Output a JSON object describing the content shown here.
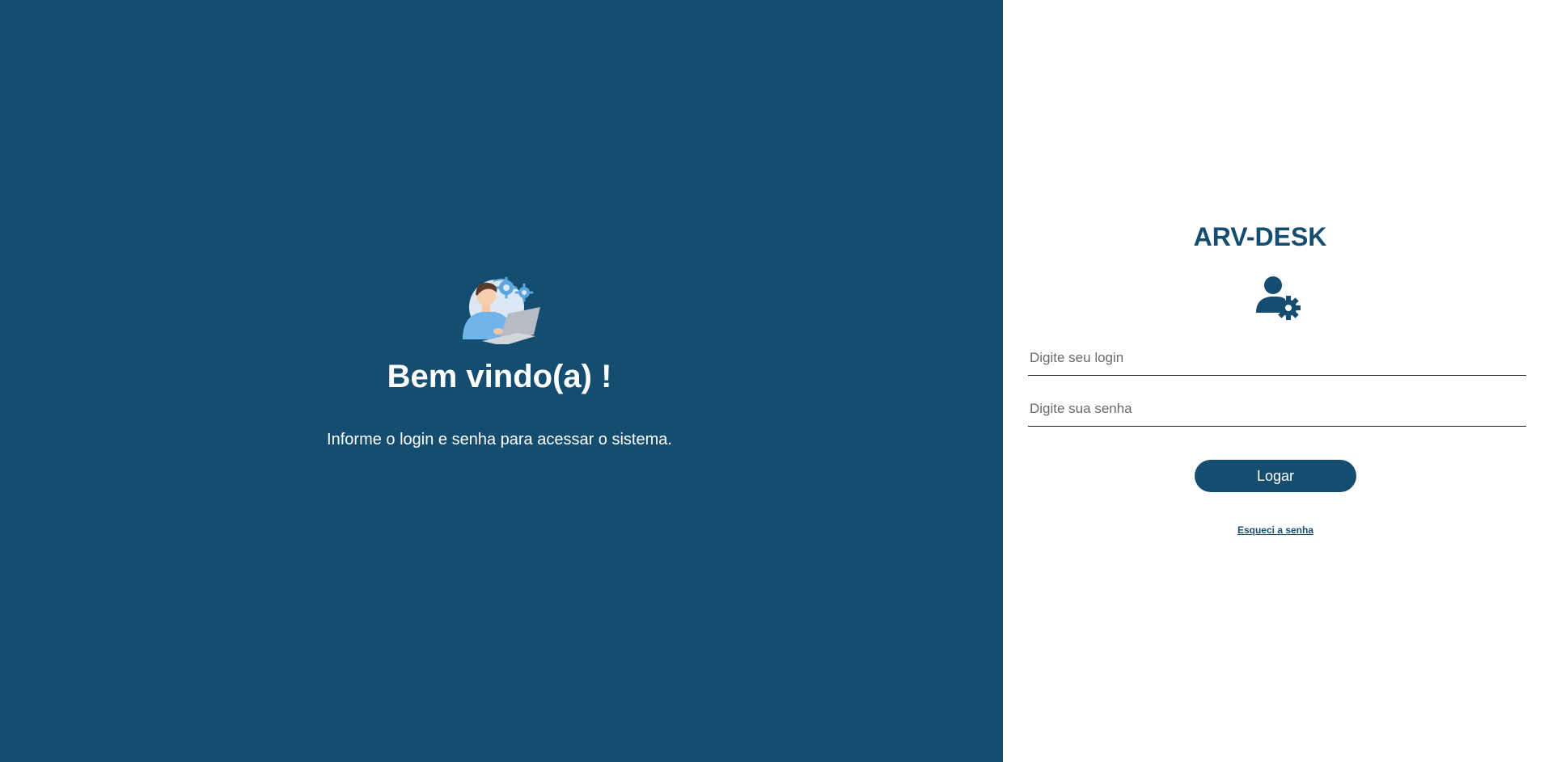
{
  "colors": {
    "brand": "#154d70",
    "panel_background": "#ffffff",
    "text_light": "#ffffff"
  },
  "welcome": {
    "illustration_icon": "person-laptop-gears-illustration",
    "title": "Bem vindo(a) !",
    "message": "Informe o login e senha para acessar o sistema."
  },
  "login_panel": {
    "app_title": "ARV-DESK",
    "icon": "user-gear-icon",
    "login_placeholder": "Digite seu login",
    "login_value": "",
    "password_placeholder": "Digite sua senha",
    "password_value": "",
    "submit_label": "Logar",
    "forgot_password_label": "Esqueci a senha"
  }
}
